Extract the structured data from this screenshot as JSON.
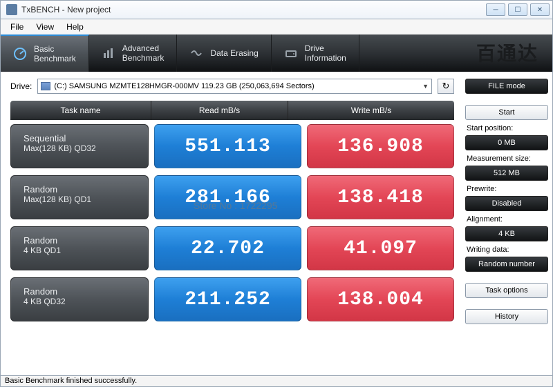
{
  "window": {
    "title": "TxBENCH - New project"
  },
  "menu": {
    "file": "File",
    "view": "View",
    "help": "Help"
  },
  "tabs": {
    "basic": "Basic\nBenchmark",
    "advanced": "Advanced\nBenchmark",
    "erase": "Data Erasing",
    "drive": "Drive\nInformation"
  },
  "watermark": "百通达",
  "drive": {
    "label": "Drive:",
    "selected": "(C:) SAMSUNG MZMTE128HMGR-000MV  119.23 GB (250,063,694 Sectors)"
  },
  "filemode": "FILE mode",
  "headers": {
    "task": "Task name",
    "read": "Read mB/s",
    "write": "Write mB/s"
  },
  "rows": [
    {
      "t1": "Sequential",
      "t2": "Max(128 KB) QD32",
      "read": "551.113",
      "write": "136.908"
    },
    {
      "t1": "Random",
      "t2": "Max(128 KB) QD1",
      "read": "281.166",
      "write": "138.418"
    },
    {
      "t1": "Random",
      "t2": "4 KB QD1",
      "read": "22.702",
      "write": "41.097"
    },
    {
      "t1": "Random",
      "t2": "4 KB QD32",
      "read": "211.252",
      "write": "138.004"
    }
  ],
  "side": {
    "start": "Start",
    "startpos_lbl": "Start position:",
    "startpos_val": "0 MB",
    "msize_lbl": "Measurement size:",
    "msize_val": "512 MB",
    "prewrite_lbl": "Prewrite:",
    "prewrite_val": "Disabled",
    "align_lbl": "Alignment:",
    "align_val": "4 KB",
    "wdata_lbl": "Writing data:",
    "wdata_val": "Random number",
    "taskopt": "Task options",
    "history": "History"
  },
  "status": "Basic Benchmark finished successfully.",
  "storewm": "Store No : 1722295"
}
